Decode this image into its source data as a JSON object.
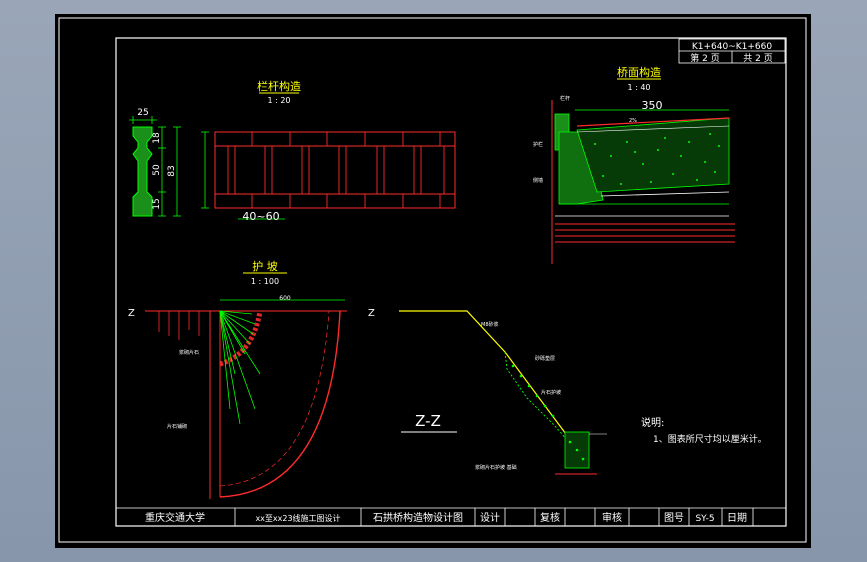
{
  "stamp": {
    "range": "K1+640~K1+660",
    "page": "第 2 页",
    "total": "共 2 页"
  },
  "railing": {
    "title": "栏杆构造",
    "scale": "1 : 20",
    "dims": {
      "width": "25",
      "top": "18",
      "mid": "50",
      "bottom": "15",
      "total": "83",
      "height": "",
      "spacing": "40~60"
    }
  },
  "deck": {
    "title": "桥面构造",
    "scale": "1 : 40",
    "width": "350",
    "slope": "2%",
    "labels": [
      "栏杆",
      "",
      "",
      "护栏",
      "侧墙",
      ""
    ]
  },
  "slope": {
    "title": "护   坡",
    "scale": "1 : 100",
    "dim": "600",
    "section_mark": "Z",
    "top_note": "",
    "labels": [
      "浆砌片石",
      "片石铺砌"
    ]
  },
  "zz": {
    "title": "Z-Z",
    "labels": [
      "M8砂浆",
      "砂砾垫层",
      "片石护坡",
      "浆砌片石护坡 基础"
    ]
  },
  "notes": {
    "title": "说明:",
    "line1": "1、图表所尺寸均以厘米计。"
  },
  "title_block": {
    "university": "重庆交通大学",
    "project": "xx至xx23线施工图设计",
    "drawing": "石拱桥构造物设计图",
    "design": "设计",
    "review": "复核",
    "approve": "审核",
    "drawing_no_label": "图号",
    "drawing_no": "SY-5",
    "date_label": "日期"
  }
}
